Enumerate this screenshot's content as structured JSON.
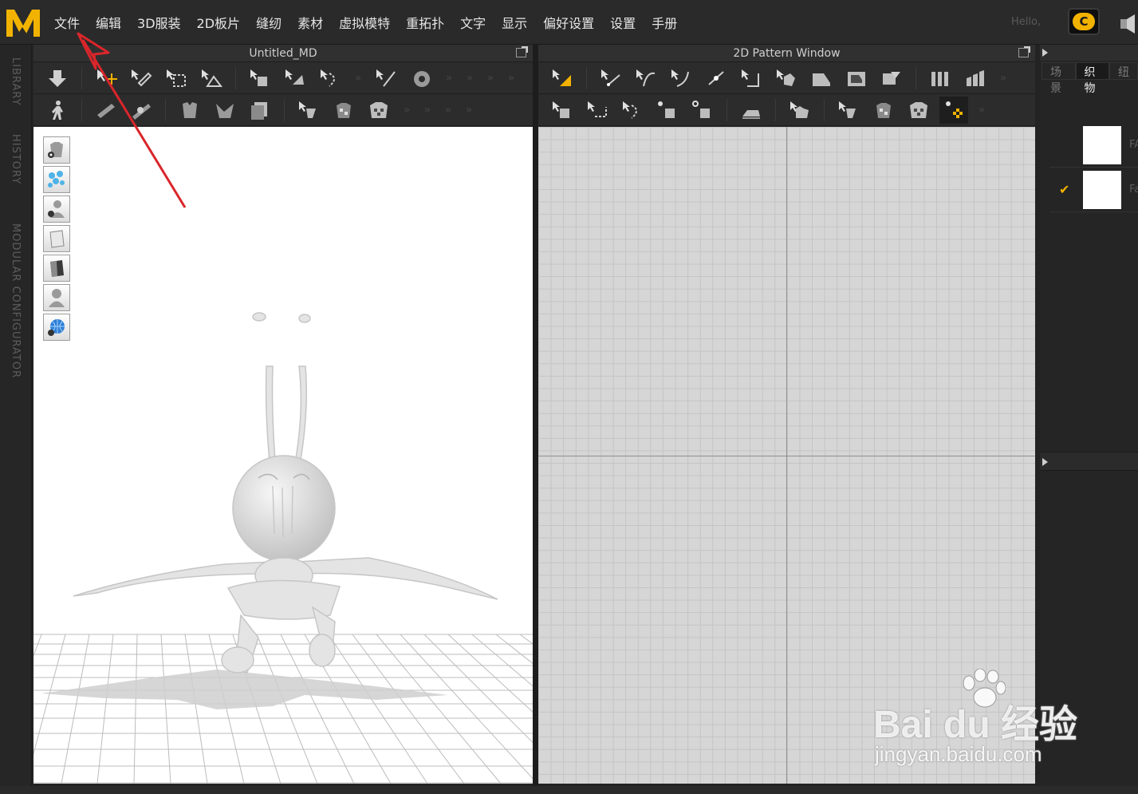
{
  "menubar": {
    "logo": "md-logo-icon",
    "items": [
      "文件",
      "编辑",
      "3D服装",
      "2D板片",
      "缝纫",
      "素材",
      "虚拟模特",
      "重拓扑",
      "文字",
      "显示",
      "偏好设置",
      "设置",
      "手册"
    ],
    "greeting": "Hello,",
    "cloud_label": "C"
  },
  "sidebar_tabs": [
    "LIBRARY",
    "HISTORY",
    "MODULAR CONFIGURATOR"
  ],
  "panel3d": {
    "title": "Untitled_MD"
  },
  "panel2d": {
    "title": "2D Pattern Window"
  },
  "rightpanel": {
    "tabs": [
      "场景",
      "织物",
      "纽"
    ],
    "active_tab": 1,
    "fabrics": [
      {
        "label": "FA",
        "checked": false
      },
      {
        "label": "Fa",
        "checked": true
      }
    ]
  },
  "watermark": {
    "brand": "Bai du 经验",
    "url": "jingyan.baidu.com"
  },
  "colors": {
    "accent": "#f2b300",
    "annotation": "#d9262b"
  }
}
